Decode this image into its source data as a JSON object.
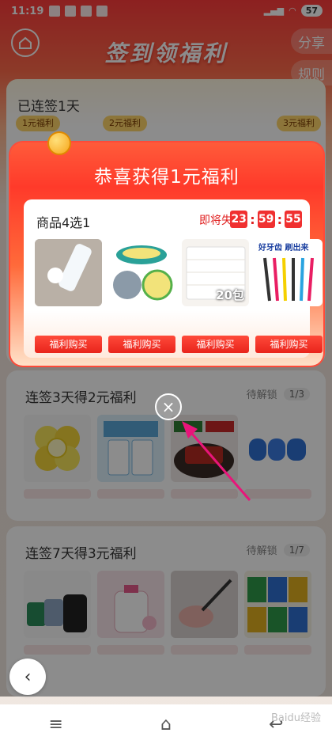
{
  "status_bar": {
    "time": "11:19",
    "battery": "57"
  },
  "header": {
    "title": "签到领福利",
    "share": "分享",
    "rules": "规则"
  },
  "signin_card": {
    "streak": "已连签1天",
    "tags": [
      "1元福利",
      "2元福利",
      "3元福利"
    ]
  },
  "modal": {
    "title": "恭喜获得1元福利",
    "pick_label": "商品4选1",
    "expire_label": "即将失效",
    "timer": {
      "h": "23",
      "m": "59",
      "s": "55"
    },
    "products": [
      {
        "name": "lotion",
        "badge": ""
      },
      {
        "name": "cleaning-ball",
        "badge": ""
      },
      {
        "name": "tissue-pack",
        "badge": "20包"
      },
      {
        "name": "toothbrush-set",
        "badge": "好牙齿 刷出来"
      }
    ],
    "buy_label": "福利购买",
    "close": "×"
  },
  "sections": [
    {
      "title": "连签3天得2元福利",
      "status": "待解锁",
      "count": "1/3",
      "colors": [
        "#f6e35a",
        "#cfe8f6",
        "#b52a22",
        "#2f6fd1"
      ]
    },
    {
      "title": "连签7天得3元福利",
      "status": "待解锁",
      "count": "1/7",
      "colors": [
        "#8ea7c3",
        "#f3d5de",
        "#d9b0a8",
        "#f0c84a"
      ]
    }
  ],
  "nav": {
    "menu": "≡",
    "home": "⌂",
    "back": "↩"
  },
  "watermark": "Baidu经验",
  "colors": {
    "accent": "#ff3b3b",
    "buy": "#e9241c",
    "arrow": "#e8157a"
  }
}
